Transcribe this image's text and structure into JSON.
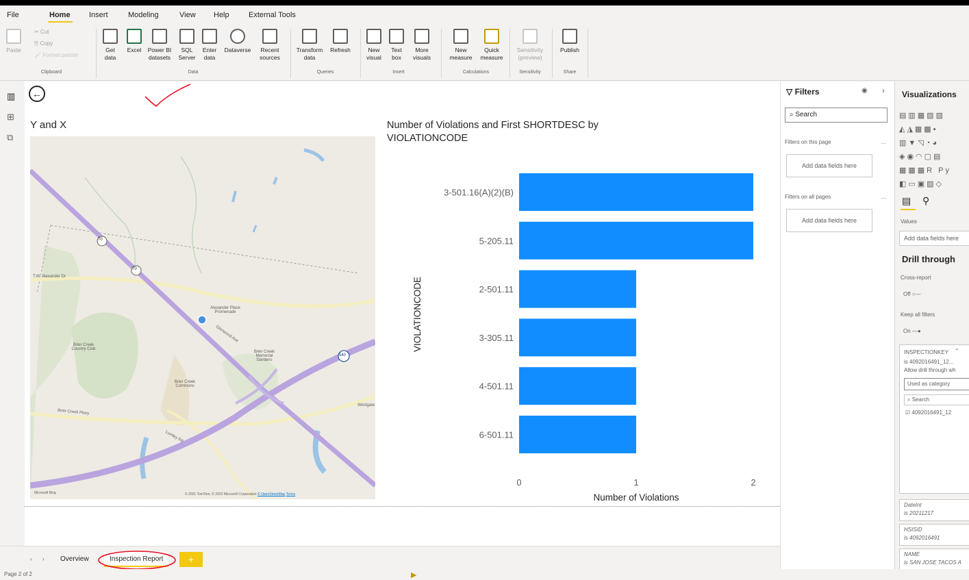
{
  "menu": {
    "items": [
      "File",
      "Home",
      "Insert",
      "Modeling",
      "View",
      "Help",
      "External Tools"
    ],
    "active": "Home"
  },
  "ribbon": {
    "clipboard": {
      "paste": "Paste",
      "cut": "Cut",
      "copy": "Copy",
      "format_painter": "Format painter",
      "group": "Clipboard"
    },
    "data": {
      "get_data": "Get data",
      "excel": "Excel",
      "powerbi": "Power BI datasets",
      "sql": "SQL Server",
      "enter": "Enter data",
      "dataverse": "Dataverse",
      "recent": "Recent sources",
      "group": "Data"
    },
    "queries": {
      "transform": "Transform data",
      "refresh": "Refresh",
      "group": "Queries"
    },
    "insert": {
      "new_visual": "New visual",
      "text_box": "Text box",
      "more": "More visuals",
      "group": "Insert"
    },
    "calculations": {
      "new_measure": "New measure",
      "quick": "Quick measure",
      "group": "Calculations"
    },
    "sensitivity": {
      "label": "Sensitivity (preview)",
      "group": "Sensitivity"
    },
    "share": {
      "publish": "Publish",
      "group": "Share"
    }
  },
  "map": {
    "title": "Y and X",
    "labels": [
      "T.W. Alexander Dr",
      "Alexander Place Promenade",
      "Glenwood Ave",
      "Brier Creek Country Club",
      "Brier Creek Memorial Gardens",
      "Brier Creek Commons",
      "Brier Creek Pkwy",
      "Lumley Rd",
      "70",
      "70",
      "540",
      "Westgate"
    ],
    "logo": "Microsoft Bing",
    "attribution": "© 2021 TomTom, © 2022 Microsoft Corporation",
    "osm": "© OpenStreetMap",
    "terms": "Terms"
  },
  "chart_data": {
    "type": "bar",
    "title": "Number of Violations and First SHORTDESC by VIOLATIONCODE",
    "title_line1": "Number of Violations and First SHORTDESC by",
    "title_line2": "VIOLATIONCODE",
    "categories": [
      "3-501.16(A)(2)(B)",
      "5-205.11",
      "2-501.11",
      "3-305.11",
      "4-501.11",
      "6-501.11"
    ],
    "values": [
      2,
      2,
      1,
      1,
      1,
      1
    ],
    "xlabel": "Number of Violations",
    "ylabel": "VIOLATIONCODE",
    "xlim": [
      0,
      2
    ],
    "xticks": [
      "0",
      "1",
      "2"
    ],
    "bar_color": "#118dff",
    "orientation": "horizontal"
  },
  "filters": {
    "title": "Filters",
    "search": "Search",
    "on_page": "Filters on this page",
    "on_all": "Filters on all pages",
    "add": "Add data fields here"
  },
  "viz": {
    "title": "Visualizations",
    "values_label": "Values",
    "values_add": "Add data fields here",
    "drill": "Drill through",
    "cross": "Cross-report",
    "off": "Off",
    "keep": "Keep all filters",
    "on": "On",
    "card": {
      "field": "INSPECTIONKEY",
      "is": "is 4092016491_12...",
      "allow": "Allow drill through wh",
      "used": "Used as category",
      "search": "Search",
      "item": "4092016491_12"
    },
    "fields": [
      {
        "name": "DateInt",
        "val": "is 20211217"
      },
      {
        "name": "HSISID",
        "val": "is 4092016491"
      },
      {
        "name": "NAME",
        "val": "is SAN JOSE TACOS A"
      }
    ]
  },
  "tabs": {
    "items": [
      "Overview",
      "Inspection Report"
    ],
    "active": "Inspection Report",
    "add": "+"
  },
  "status": {
    "page": "Page 2 of 2"
  }
}
